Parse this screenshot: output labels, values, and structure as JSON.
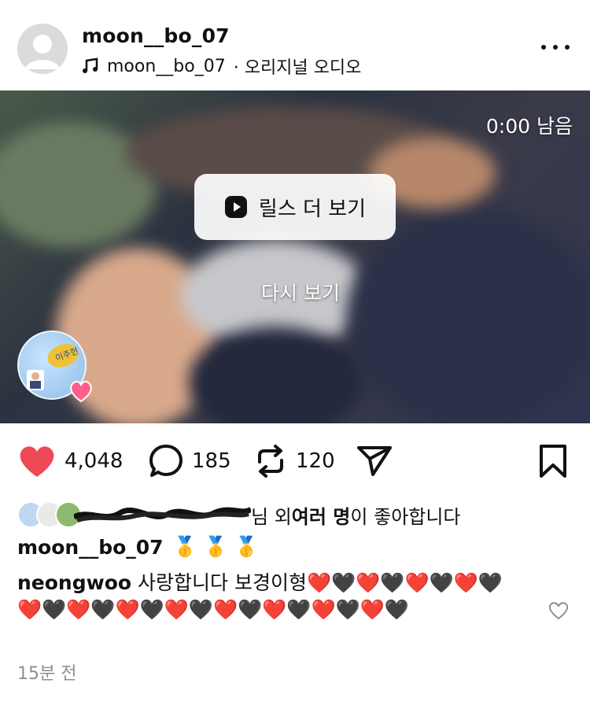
{
  "post": {
    "username": "moon__bo_07",
    "audio_user": "moon__bo_07",
    "audio_label": "· 오리지널 오디오"
  },
  "video": {
    "time_left": "0:00 남음",
    "reels_button": "릴스 더 보기",
    "replay": "다시 보기",
    "sticker_text": "이주헌"
  },
  "actions": {
    "likes": "4,048",
    "comments": "185",
    "reposts": "120"
  },
  "liked_by": {
    "suffix": "님 외 ",
    "bold": "여러 명",
    "tail": "이 좋아합니다"
  },
  "caption": {
    "username": "moon__bo_07",
    "emojis": "🥇 🥇 🥇"
  },
  "comment": {
    "username": "neongwoo",
    "text": " 사랑합니다 보경이형",
    "emojis": "❤️🖤❤️🖤❤️🖤❤️🖤❤️🖤❤️🖤❤️🖤❤️🖤❤️🖤❤️🖤❤️🖤❤️🖤"
  },
  "timestamp": "15분 전",
  "colors": {
    "like_red": "#ed4956",
    "text": "#111111",
    "muted": "#8e8e8e"
  }
}
